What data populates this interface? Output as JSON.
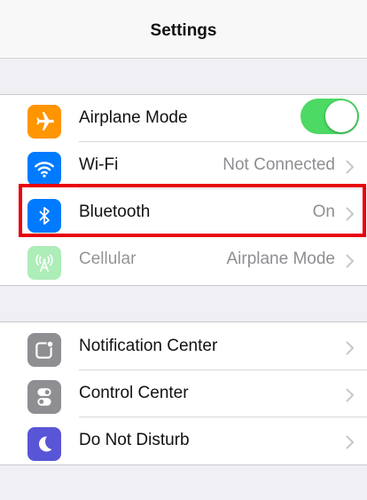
{
  "nav": {
    "title": "Settings"
  },
  "colors": {
    "airplane": "#ff9500",
    "wifi": "#007aff",
    "bluetooth": "#007aff",
    "cellular": "#4cd964",
    "notification": "#8e8e93",
    "control": "#8e8e93",
    "dnd": "#5856d6",
    "highlight": "#e8000b",
    "toggle_on": "#4cd964"
  },
  "group1": {
    "rows": [
      {
        "label": "Airplane Mode",
        "icon": "airplane-icon",
        "toggle_on": true
      },
      {
        "label": "Wi-Fi",
        "value": "Not Connected",
        "icon": "wifi-icon"
      },
      {
        "label": "Bluetooth",
        "value": "On",
        "icon": "bluetooth-icon",
        "highlighted": true
      },
      {
        "label": "Cellular",
        "value": "Airplane Mode",
        "icon": "cellular-antenna-icon",
        "disabled": true
      }
    ]
  },
  "group2": {
    "rows": [
      {
        "label": "Notification Center",
        "icon": "notification-center-icon"
      },
      {
        "label": "Control Center",
        "icon": "control-center-icon"
      },
      {
        "label": "Do Not Disturb",
        "icon": "moon-icon"
      }
    ]
  }
}
